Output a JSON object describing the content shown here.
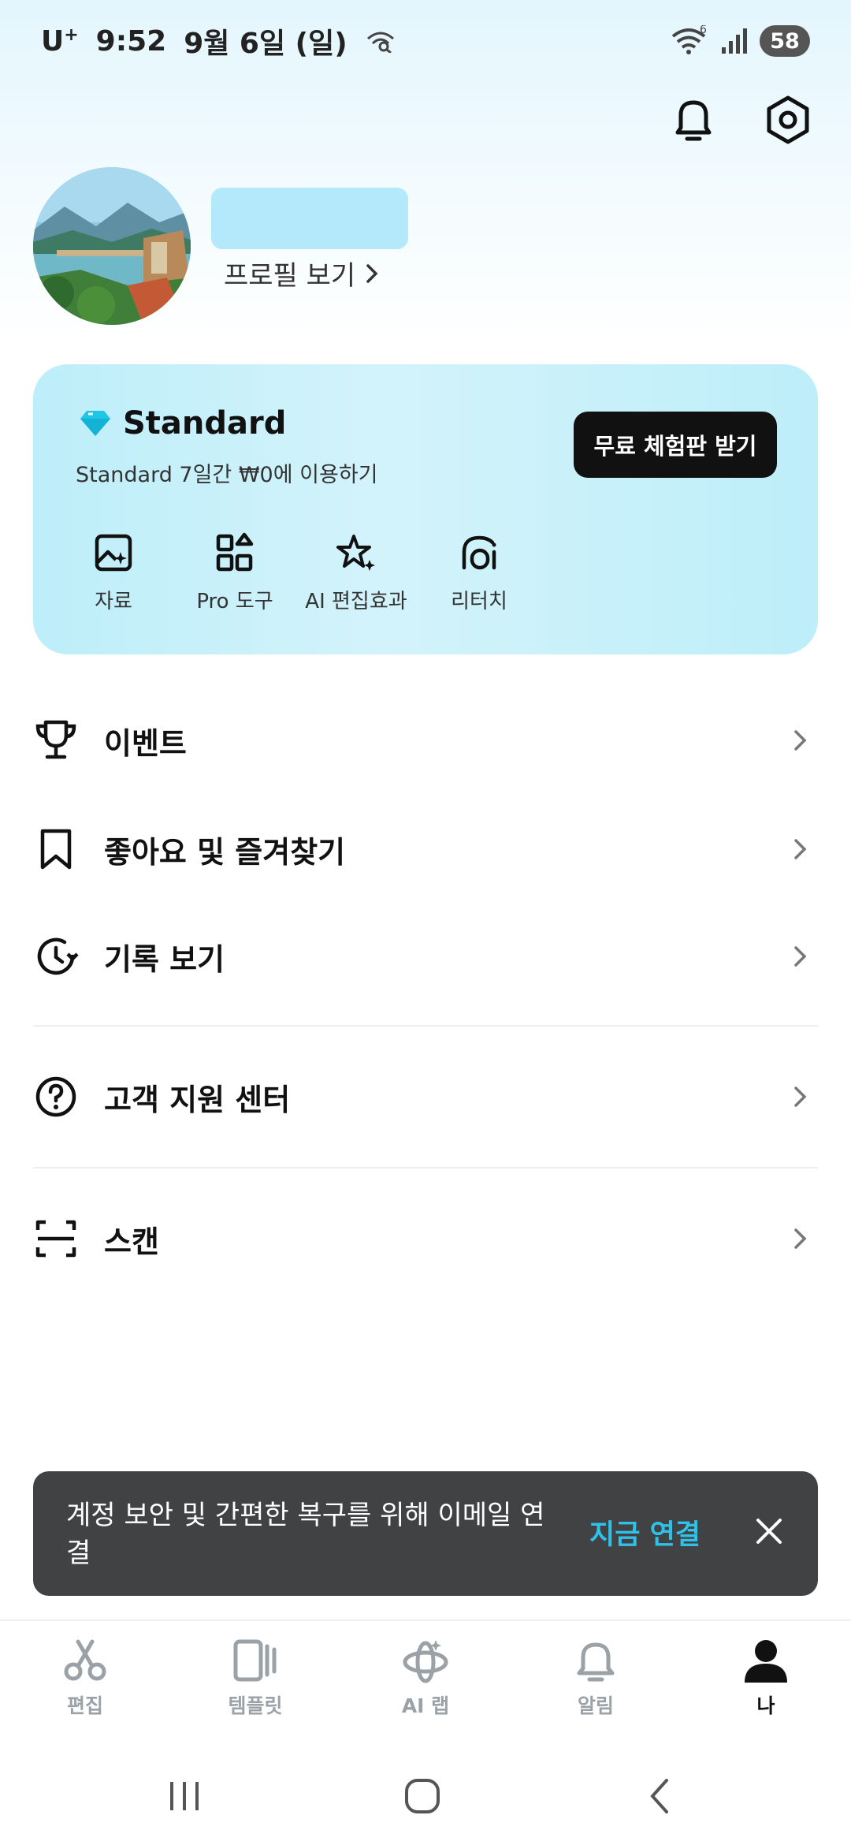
{
  "status_bar": {
    "carrier": "U",
    "carrier_sup": "+",
    "time": "9:52",
    "date": "9월 6일 (일)",
    "wifi_badge": "6",
    "battery": "58"
  },
  "header": {
    "bell_icon": "bell-icon",
    "settings_icon": "settings-hexagon-icon"
  },
  "profile": {
    "view_profile_label": "프로필 보기"
  },
  "standard_card": {
    "title": "Standard",
    "subtitle": "Standard 7일간 ₩0에 이용하기",
    "trial_button": "무료 체험판 받기",
    "features": [
      {
        "label": "자료",
        "icon": "image-sparkle-icon"
      },
      {
        "label": "Pro 도구",
        "icon": "grid-shapes-icon"
      },
      {
        "label": "AI 편집효과",
        "icon": "stars-icon"
      },
      {
        "label": "리터치",
        "icon": "face-retouch-icon"
      }
    ],
    "accent": "#2fc1e8"
  },
  "menu": {
    "items": [
      {
        "label": "이벤트",
        "icon": "trophy-icon"
      },
      {
        "label": "좋아요 및 즐겨찾기",
        "icon": "bookmark-icon"
      },
      {
        "label": "기록 보기",
        "icon": "history-clock-icon"
      },
      {
        "label": "고객 지원 센터",
        "icon": "help-circle-icon"
      },
      {
        "label": "스캔",
        "icon": "scan-icon"
      }
    ]
  },
  "snackbar": {
    "message": "계정 보안 및 간편한 복구를 위해 이메일 연결",
    "action": "지금 연결"
  },
  "bottom_nav": {
    "items": [
      {
        "label": "편집",
        "icon": "scissors-icon"
      },
      {
        "label": "템플릿",
        "icon": "template-icon"
      },
      {
        "label": "AI 랩",
        "icon": "ai-lab-icon"
      },
      {
        "label": "알림",
        "icon": "bell-icon"
      },
      {
        "label": "나",
        "icon": "person-icon",
        "active": true
      }
    ]
  }
}
